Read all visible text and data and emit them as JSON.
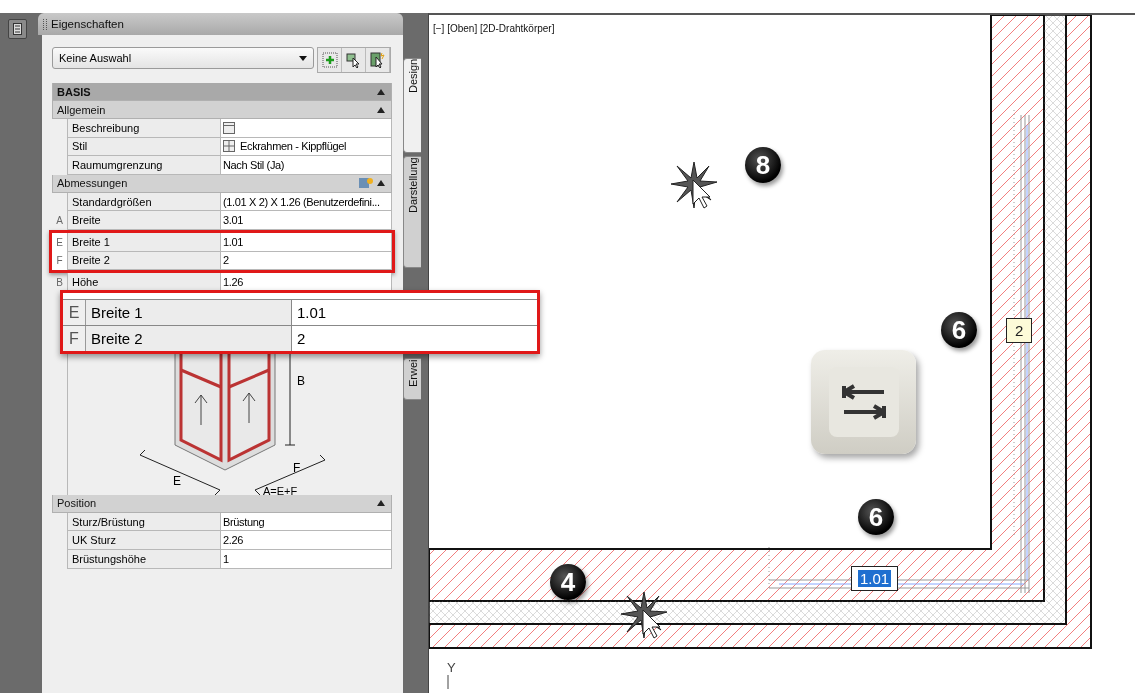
{
  "palette": {
    "title": "Eigenschaften",
    "selection": "Keine Auswahl",
    "tabs": [
      {
        "label": "Design",
        "selected": true
      },
      {
        "label": "Darstellung",
        "selected": false
      },
      {
        "label": "Erwei",
        "selected": false
      }
    ],
    "groups": [
      {
        "title": "BASIS",
        "kind": "category",
        "expanded": true
      },
      {
        "title": "Allgemein",
        "kind": "group",
        "expanded": true,
        "rows": [
          {
            "kind": "icon",
            "label": "Beschreibung",
            "highlighted": false
          },
          {
            "kind": "icon-text",
            "label": "Stil",
            "value": "Eckrahmen - Kippflügel",
            "highlighted": false
          },
          {
            "kind": "text",
            "label": "Raumumgrenzung",
            "value": "Nach Stil (Ja)",
            "highlighted": false
          }
        ]
      },
      {
        "title": "Abmessungen",
        "kind": "group-tool",
        "expanded": true,
        "rows": [
          {
            "kind": "text",
            "label": "Standardgrößen",
            "value": "(1.01 X 2) X 1.26 (Benutzerdefini...",
            "highlighted": false
          },
          {
            "kind": "text",
            "marker": "A",
            "label": "Breite",
            "value": "3.01",
            "highlighted": false
          },
          {
            "kind": "text",
            "marker": "E",
            "label": "Breite 1",
            "value": "1.01",
            "highlighted": true
          },
          {
            "kind": "text",
            "marker": "F",
            "label": "Breite 2",
            "value": "2",
            "highlighted": true
          },
          {
            "kind": "text",
            "marker": "B",
            "label": "Höhe",
            "value": "1.26",
            "highlighted": false
          },
          {
            "kind": "diagram",
            "labels": [
              "B",
              "E",
              "F",
              "A=E+F"
            ],
            "highlighted": false
          }
        ]
      },
      {
        "title": "Position",
        "kind": "group",
        "expanded": true,
        "rows": [
          {
            "kind": "text",
            "label": "Sturz/Brüstung",
            "value": "Brüstung",
            "highlighted": false
          },
          {
            "kind": "text",
            "label": "UK Sturz",
            "value": "2.26",
            "highlighted": false
          },
          {
            "kind": "text",
            "label": "Brüstungshöhe",
            "value": "1",
            "highlighted": false
          }
        ]
      }
    ]
  },
  "callout": {
    "rows": [
      {
        "marker": "E",
        "label": "Breite 1",
        "value": "1.01"
      },
      {
        "marker": "F",
        "label": "Breite 2",
        "value": "2"
      }
    ]
  },
  "viewport": {
    "label": "[−] [Oben] [2D-Drahtkörper]",
    "steps": [
      "8",
      "6",
      "6",
      "4"
    ],
    "dimension_inputs": [
      {
        "value": "2",
        "selected": false
      },
      {
        "value": "1.01",
        "selected": true
      }
    ],
    "axis_label": "Y"
  }
}
